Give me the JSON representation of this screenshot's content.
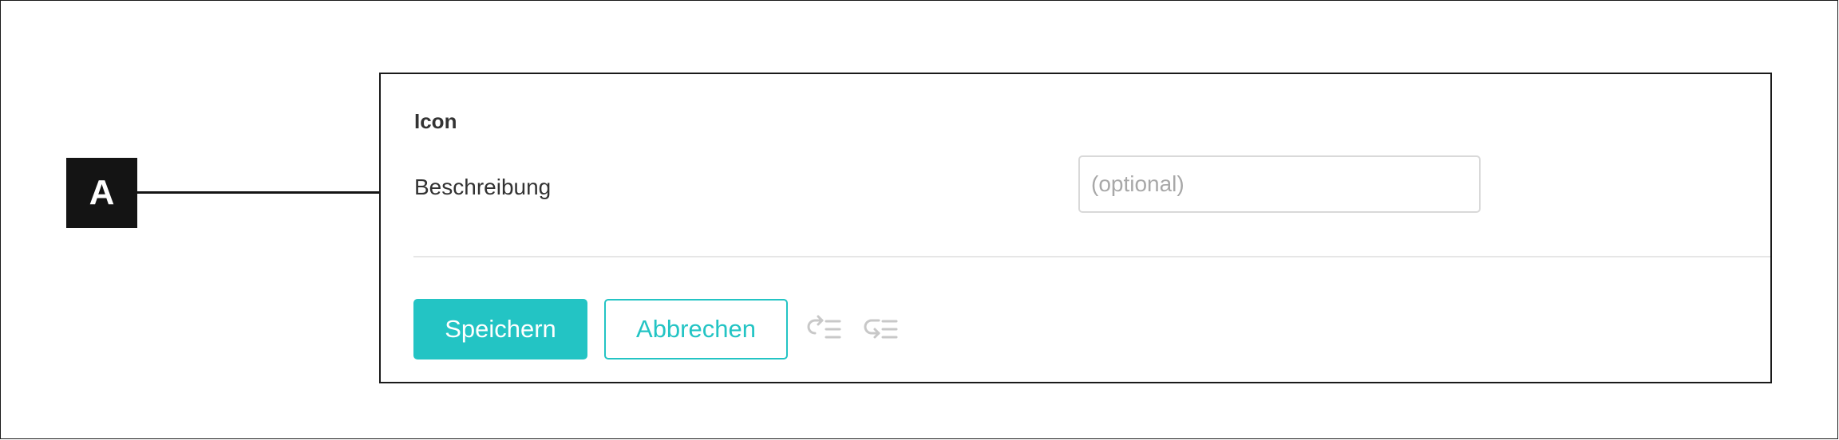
{
  "callout": {
    "label": "A"
  },
  "panel": {
    "section_title": "Icon",
    "description_field": {
      "label": "Beschreibung",
      "value": "",
      "placeholder": "(optional)"
    },
    "actions": {
      "save_label": "Speichern",
      "cancel_label": "Abbrechen",
      "outdent_icon": "outdent-icon",
      "indent_icon": "indent-icon"
    }
  },
  "colors": {
    "accent": "#23c4c4",
    "callout_badge": "#141414",
    "icon_disabled": "#c8c8c8",
    "text": "#333333",
    "placeholder": "#a8a8a8"
  }
}
